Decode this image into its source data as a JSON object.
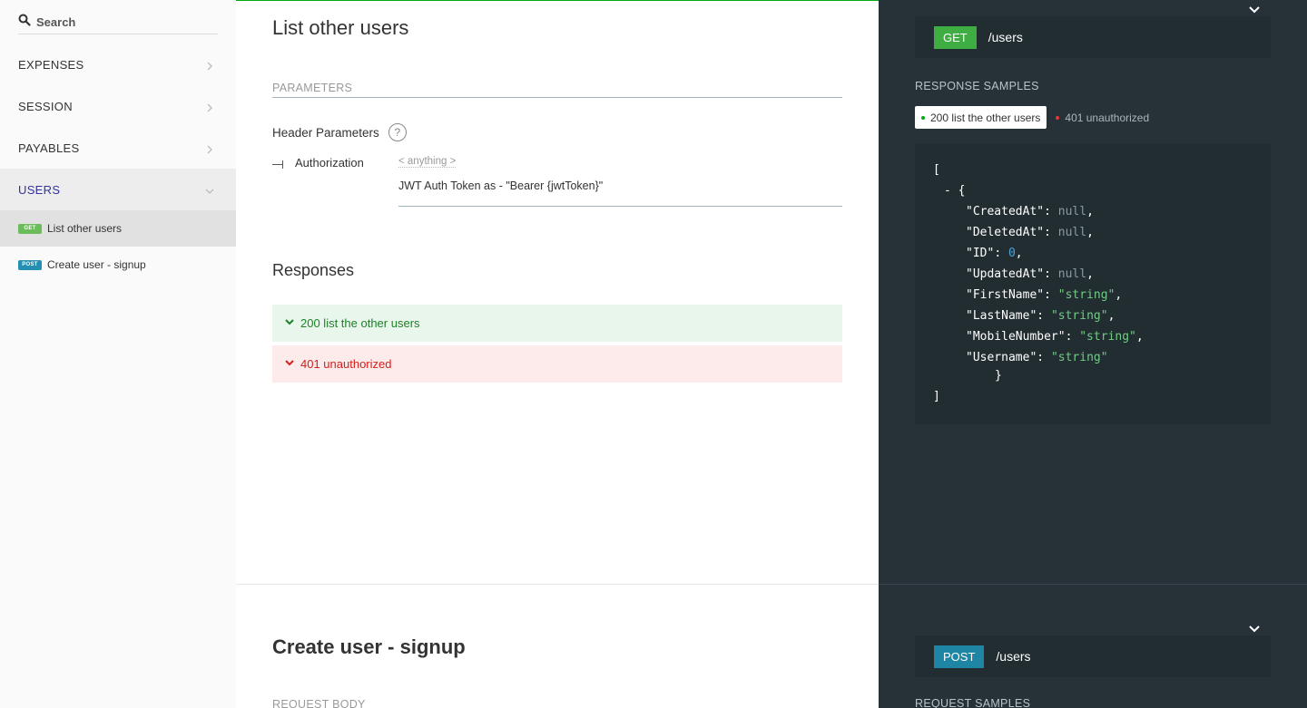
{
  "sidebar": {
    "search_placeholder": "Search",
    "items": [
      {
        "label": "EXPENSES"
      },
      {
        "label": "SESSION"
      },
      {
        "label": "PAYABLES"
      },
      {
        "label": "USERS"
      }
    ],
    "sub_items": [
      {
        "method": "GET",
        "label": "List other users"
      },
      {
        "method": "POST",
        "label": "Create user - signup"
      }
    ]
  },
  "main": {
    "title": "List other users",
    "parameters_label": "PARAMETERS",
    "header_parameters_label": "Header Parameters",
    "help_glyph": "?",
    "param": {
      "name": "Authorization",
      "type": "< anything >",
      "description": "JWT Auth Token as - \"Bearer {jwtToken}\""
    },
    "responses_label": "Responses",
    "responses": [
      {
        "label": "200 list the other users",
        "color": "#1d8127"
      },
      {
        "label": "401 unauthorized",
        "color": "#d41f1c"
      }
    ],
    "next_title": "Create user - signup",
    "request_body_label": "REQUEST BODY"
  },
  "right": {
    "get_endpoint": {
      "verb": "GET",
      "path": "/users"
    },
    "response_samples_label": "RESPONSE SAMPLES",
    "tabs": [
      {
        "label": "200 list the other users"
      },
      {
        "label": "401 unauthorized"
      }
    ],
    "code": {
      "open_bracket": "[",
      "collapse": "- {",
      "fields": [
        {
          "key": "\"CreatedAt\"",
          "value": "null",
          "kind": "null",
          "comma": ","
        },
        {
          "key": "\"DeletedAt\"",
          "value": "null",
          "kind": "null",
          "comma": ","
        },
        {
          "key": "\"ID\"",
          "value": "0",
          "kind": "num",
          "comma": ","
        },
        {
          "key": "\"UpdatedAt\"",
          "value": "null",
          "kind": "null",
          "comma": ","
        },
        {
          "key": "\"FirstName\"",
          "value": "\"string\"",
          "kind": "str",
          "comma": ","
        },
        {
          "key": "\"LastName\"",
          "value": "\"string\"",
          "kind": "str",
          "comma": ","
        },
        {
          "key": "\"MobileNumber\"",
          "value": "\"string\"",
          "kind": "str",
          "comma": ","
        },
        {
          "key": "\"Username\"",
          "value": "\"string\"",
          "kind": "str",
          "comma": ""
        }
      ],
      "close_brace": "}",
      "close_bracket": "]"
    },
    "post_endpoint": {
      "verb": "POST",
      "path": "/users"
    },
    "request_samples_label": "REQUEST SAMPLES"
  }
}
